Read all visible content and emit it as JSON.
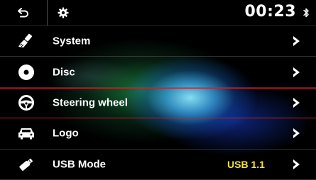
{
  "header": {
    "back_icon": "back-arrow-icon",
    "settings_icon": "gear-icon",
    "clock": "00:23",
    "bluetooth_icon": "bluetooth-icon"
  },
  "menu": {
    "items": [
      {
        "label": "System",
        "icon": "brush-icon",
        "value": "",
        "selected": false
      },
      {
        "label": "Disc",
        "icon": "disc-icon",
        "value": "",
        "selected": false
      },
      {
        "label": "Steering wheel",
        "icon": "steering-wheel-icon",
        "value": "",
        "selected": true
      },
      {
        "label": "Logo",
        "icon": "car-icon",
        "value": "",
        "selected": false
      },
      {
        "label": "USB Mode",
        "icon": "usb-icon",
        "value": "USB 1.1",
        "selected": false
      }
    ]
  },
  "colors": {
    "value_text": "#f2e23a",
    "selection_line": "#c0242b",
    "background": "#000000"
  }
}
